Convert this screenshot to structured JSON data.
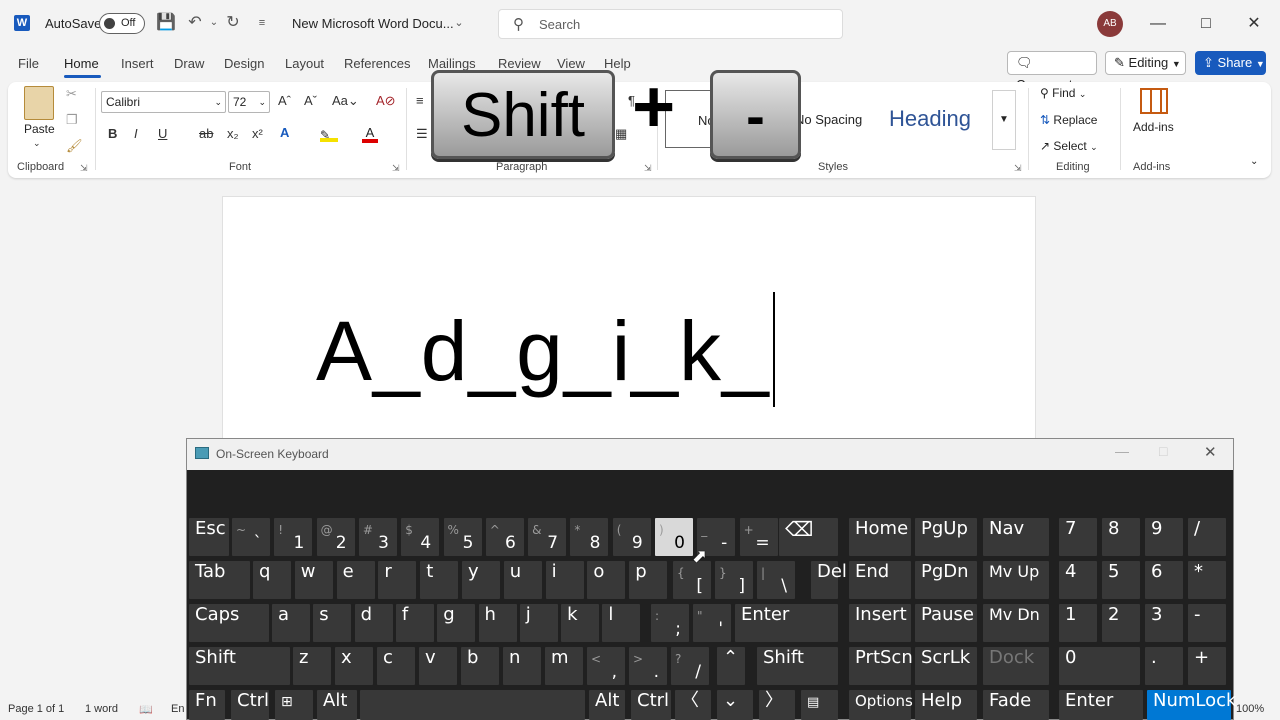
{
  "titlebar": {
    "app_logo": "W",
    "autosave_label": "AutoSave",
    "autosave_state": "Off",
    "doc_title": "New Microsoft Word Docu...",
    "search_placeholder": "Search",
    "avatar_initials": "AB"
  },
  "menu": {
    "tabs": [
      "File",
      "Home",
      "Insert",
      "Draw",
      "Design",
      "Layout",
      "References",
      "Mailings",
      "Review",
      "View",
      "Help"
    ],
    "active": "Home",
    "comments": "Comments",
    "editing": "Editing",
    "share": "Share"
  },
  "ribbon": {
    "clipboard": {
      "paste": "Paste",
      "label": "Clipboard"
    },
    "font": {
      "name": "Calibri",
      "size": "72",
      "label": "Font"
    },
    "paragraph": {
      "label": "Paragraph"
    },
    "styles": {
      "label": "Styles",
      "items": [
        "No Spacing",
        "Heading"
      ],
      "partial_normal": "No"
    },
    "editing": {
      "find": "Find",
      "replace": "Replace",
      "select": "Select",
      "label": "Editing"
    },
    "addins": {
      "button": "Add-ins",
      "label": "Add-ins"
    }
  },
  "overlay": {
    "key1": "Shift",
    "plus": "+",
    "key2": "-"
  },
  "document": {
    "text": "A_d_g_i_k_"
  },
  "statusbar": {
    "page": "Page 1 of 1",
    "words": "1 word",
    "lang": "En",
    "zoom": "100%"
  },
  "osk": {
    "title": "On-Screen Keyboard",
    "keys": {
      "esc": "Esc",
      "tab": "Tab",
      "caps": "Caps",
      "shift": "Shift",
      "shift_r": "Shift",
      "fn": "Fn",
      "ctrl": "Ctrl",
      "alt": "Alt",
      "alt_r": "Alt",
      "ctrl_r": "Ctrl",
      "del": "Del",
      "enter": "Enter",
      "home": "Home",
      "pgup": "PgUp",
      "nav": "Nav",
      "end": "End",
      "pgdn": "PgDn",
      "mvup": "Mv Up",
      "insert": "Insert",
      "pause": "Pause",
      "mvdn": "Mv Dn",
      "prtscn": "PrtScn",
      "scrlk": "ScrLk",
      "dock": "Dock",
      "options": "Options",
      "help": "Help",
      "fade": "Fade",
      "np_enter": "Enter",
      "numlock": "NumLock"
    },
    "row1": [
      {
        "s": "~",
        "m": "`"
      },
      {
        "s": "!",
        "m": "1"
      },
      {
        "s": "@",
        "m": "2"
      },
      {
        "s": "#",
        "m": "3"
      },
      {
        "s": "$",
        "m": "4"
      },
      {
        "s": "%",
        "m": "5"
      },
      {
        "s": "^",
        "m": "6"
      },
      {
        "s": "&",
        "m": "7"
      },
      {
        "s": "*",
        "m": "8"
      },
      {
        "s": "(",
        "m": "9"
      },
      {
        "s": ")",
        "m": "0"
      },
      {
        "s": "_",
        "m": "-"
      },
      {
        "s": "+",
        "m": "="
      }
    ],
    "row2": [
      "q",
      "w",
      "e",
      "r",
      "t",
      "y",
      "u",
      "i",
      "o",
      "p"
    ],
    "row2_sym": [
      {
        "s": "{",
        "m": "["
      },
      {
        "s": "}",
        "m": "]"
      },
      {
        "s": "|",
        "m": "\\"
      }
    ],
    "row3": [
      "a",
      "s",
      "d",
      "f",
      "g",
      "h",
      "j",
      "k",
      "l"
    ],
    "row3_sym": [
      {
        "s": ":",
        "m": ";"
      },
      {
        "s": "\"",
        "m": "'"
      }
    ],
    "row4": [
      "z",
      "x",
      "c",
      "v",
      "b",
      "n",
      "m"
    ],
    "row4_sym": [
      {
        "s": "<",
        "m": ","
      },
      {
        "s": ">",
        "m": "."
      },
      {
        "s": "?",
        "m": "/"
      }
    ],
    "numpad": [
      [
        "7",
        "8",
        "9",
        "/"
      ],
      [
        "4",
        "5",
        "6",
        "*"
      ],
      [
        "1",
        "2",
        "3",
        "-"
      ],
      [
        "0",
        ".",
        "+"
      ]
    ]
  }
}
